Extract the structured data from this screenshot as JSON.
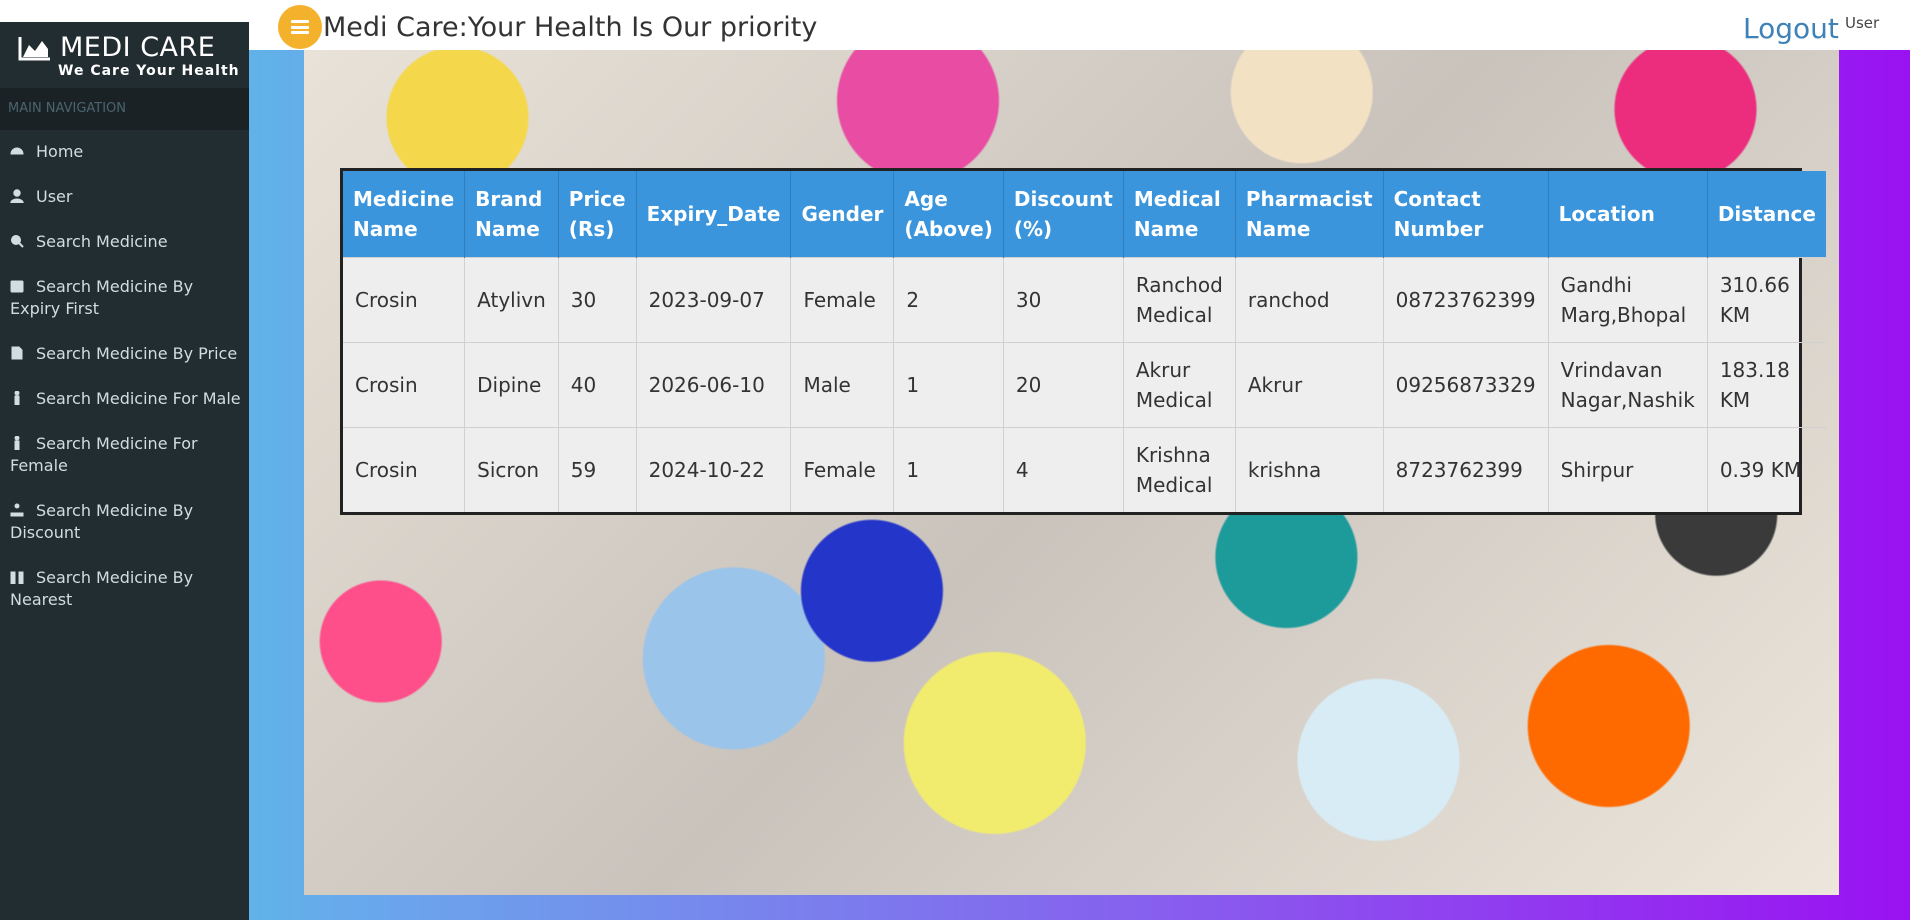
{
  "brand": {
    "title": "MEDI CARE",
    "subtitle": "We Care Your Health"
  },
  "nav": {
    "header": "MAIN NAVIGATION",
    "items": [
      {
        "label": "Home",
        "icon": "dashboard-icon"
      },
      {
        "label": "User",
        "icon": "user-icon"
      },
      {
        "label": "Search Medicine",
        "icon": "search-icon"
      },
      {
        "label": "Search Medicine By Expiry First",
        "icon": "calendar-icon"
      },
      {
        "label": "Search Medicine By Price",
        "icon": "document-icon"
      },
      {
        "label": "Search Medicine For Male",
        "icon": "male-icon"
      },
      {
        "label": "Search Medicine For Female",
        "icon": "female-icon"
      },
      {
        "label": "Search Medicine By Discount",
        "icon": "discount-icon"
      },
      {
        "label": "Search Medicine By Nearest",
        "icon": "nearest-icon"
      }
    ]
  },
  "header": {
    "title": "Medi Care:Your Health Is Our priority",
    "logout": "Logout",
    "user": "User"
  },
  "table": {
    "columns": [
      "Medicine Name",
      "Brand Name",
      "Price (Rs)",
      "Expiry_Date",
      "Gender",
      "Age (Above)",
      "Discount (%)",
      "Medical Name",
      "Pharmacist Name",
      "Contact Number",
      "Location",
      "Distance"
    ],
    "rows": [
      [
        "Crosin",
        "Atylivn",
        "30",
        "2023-09-07",
        "Female",
        "2",
        "30",
        "Ranchod Medical",
        "ranchod",
        "08723762399",
        "Gandhi Marg,Bhopal",
        "310.66 KM"
      ],
      [
        "Crosin",
        "Dipine",
        "40",
        "2026-06-10",
        "Male",
        "1",
        "20",
        "Akrur Medical",
        "Akrur",
        "09256873329",
        "Vrindavan Nagar,Nashik",
        "183.18 KM"
      ],
      [
        "Crosin",
        "Sicron",
        "59",
        "2024-10-22",
        "Female",
        "1",
        "4",
        "Krishna Medical",
        "krishna",
        "8723762399",
        "Shirpur",
        "0.39 KM"
      ]
    ]
  },
  "colors": {
    "sidebar": "#222d32",
    "table_header": "#3b95dc",
    "toggle": "#f4b22c",
    "logout": "#3f82b7"
  }
}
